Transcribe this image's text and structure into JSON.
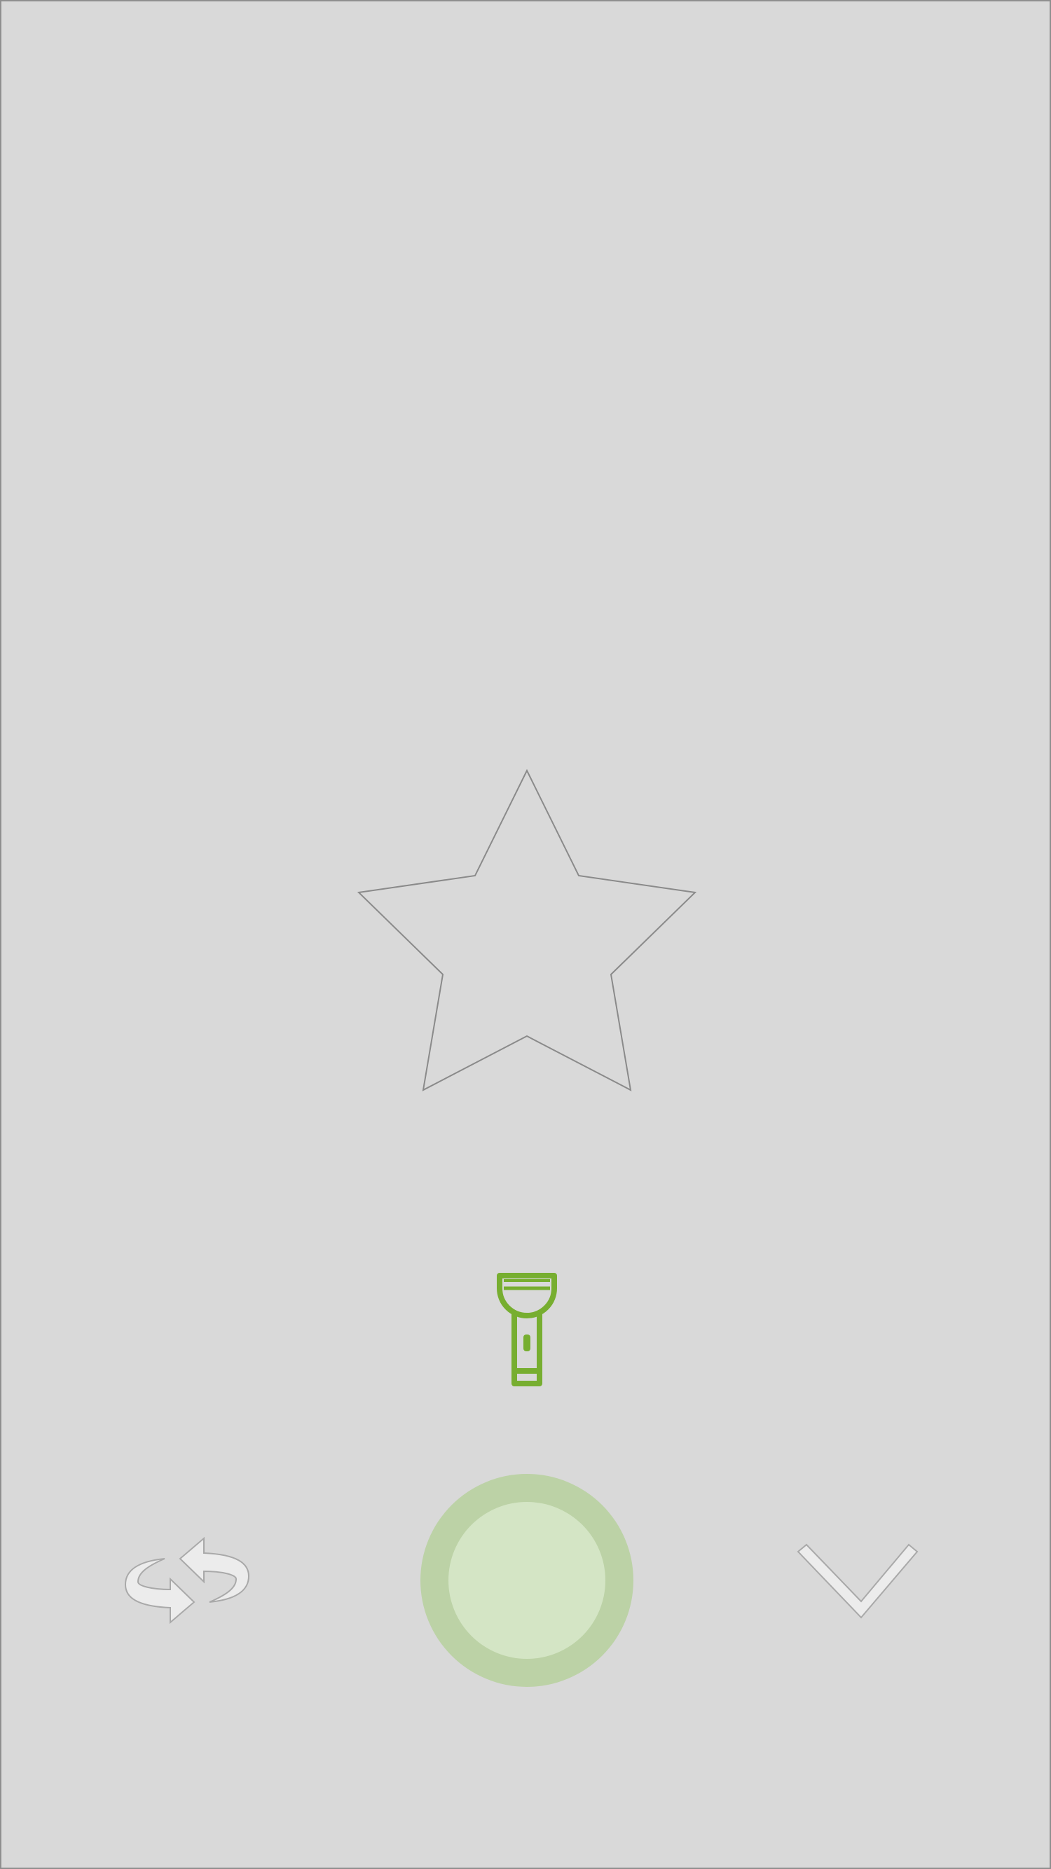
{
  "screen": {
    "background": "#d9d9d9",
    "border_color": "#8f8f8f"
  },
  "favorite": {
    "icon": "star-outline-icon",
    "stroke": "#8a8a8a"
  },
  "flashlight": {
    "icon": "flashlight-icon",
    "color": "#77ae30"
  },
  "power": {
    "outer_color": "#bcd2a6",
    "inner_color": "#d4e5c5"
  },
  "switch_camera": {
    "icon": "swap-arrows-icon",
    "color": "#ececec"
  },
  "collapse": {
    "icon": "chevron-down-icon",
    "color": "#ececec"
  }
}
